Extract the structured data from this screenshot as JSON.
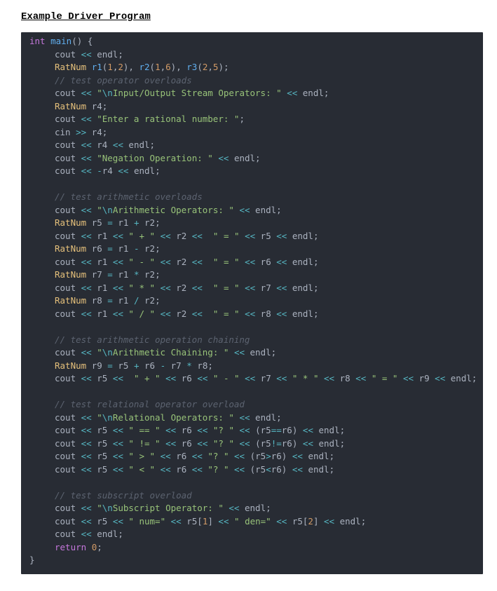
{
  "heading": "Example Driver Program",
  "code": {
    "lines": [
      {
        "indent": 0,
        "html": "<span class=\"k\">int</span> <span class=\"fn\">main</span><span class=\"p\">() {</span>"
      },
      {
        "indent": 1,
        "html": "<span class=\"v\">cout</span> <span class=\"o\">&lt;&lt;</span> <span class=\"v\">endl</span><span class=\"p\">;</span>"
      },
      {
        "indent": 1,
        "html": "<span class=\"ty\">RatNum</span> <span class=\"fn\">r1</span><span class=\"p\">(</span><span class=\"n\">1</span><span class=\"p\">,</span><span class=\"n\">2</span><span class=\"p\">)</span><span class=\"p\">,</span> <span class=\"fn\">r2</span><span class=\"p\">(</span><span class=\"n\">1</span><span class=\"p\">,</span><span class=\"n\">6</span><span class=\"p\">)</span><span class=\"p\">,</span> <span class=\"fn\">r3</span><span class=\"p\">(</span><span class=\"n\">2</span><span class=\"p\">,</span><span class=\"n\">5</span><span class=\"p\">)</span><span class=\"p\">;</span>"
      },
      {
        "indent": 1,
        "html": "<span class=\"c\">// test operator overloads</span>"
      },
      {
        "indent": 1,
        "html": "<span class=\"v\">cout</span> <span class=\"o\">&lt;&lt;</span> <span class=\"s\">\"</span><span class=\"esc\">\\n</span><span class=\"s\">Input/Output Stream Operators: \"</span> <span class=\"o\">&lt;&lt;</span> <span class=\"v\">endl</span><span class=\"p\">;</span>"
      },
      {
        "indent": 1,
        "html": "<span class=\"ty\">RatNum</span> <span class=\"v\">r4</span><span class=\"p\">;</span>"
      },
      {
        "indent": 1,
        "html": "<span class=\"v\">cout</span> <span class=\"o\">&lt;&lt;</span> <span class=\"s\">\"Enter a rational number: \"</span><span class=\"p\">;</span>"
      },
      {
        "indent": 1,
        "html": "<span class=\"v\">cin</span> <span class=\"o\">&gt;&gt;</span> <span class=\"v\">r4</span><span class=\"p\">;</span>"
      },
      {
        "indent": 1,
        "html": "<span class=\"v\">cout</span> <span class=\"o\">&lt;&lt;</span> <span class=\"v\">r4</span> <span class=\"o\">&lt;&lt;</span> <span class=\"v\">endl</span><span class=\"p\">;</span>"
      },
      {
        "indent": 1,
        "html": "<span class=\"v\">cout</span> <span class=\"o\">&lt;&lt;</span> <span class=\"s\">\"Negation Operation: \"</span> <span class=\"o\">&lt;&lt;</span> <span class=\"v\">endl</span><span class=\"p\">;</span>"
      },
      {
        "indent": 1,
        "html": "<span class=\"v\">cout</span> <span class=\"o\">&lt;&lt;</span> <span class=\"o\">-</span><span class=\"v\">r4</span> <span class=\"o\">&lt;&lt;</span> <span class=\"v\">endl</span><span class=\"p\">;</span>"
      },
      {
        "indent": 1,
        "html": "&nbsp;"
      },
      {
        "indent": 1,
        "html": "<span class=\"c\">// test arithmetic overloads</span>"
      },
      {
        "indent": 1,
        "html": "<span class=\"v\">cout</span> <span class=\"o\">&lt;&lt;</span> <span class=\"s\">\"</span><span class=\"esc\">\\n</span><span class=\"s\">Arithmetic Operators: \"</span> <span class=\"o\">&lt;&lt;</span> <span class=\"v\">endl</span><span class=\"p\">;</span>"
      },
      {
        "indent": 1,
        "html": "<span class=\"ty\">RatNum</span> <span class=\"v\">r5</span> <span class=\"o\">=</span> <span class=\"v\">r1</span> <span class=\"o\">+</span> <span class=\"v\">r2</span><span class=\"p\">;</span>"
      },
      {
        "indent": 1,
        "html": "<span class=\"v\">cout</span> <span class=\"o\">&lt;&lt;</span> <span class=\"v\">r1</span> <span class=\"o\">&lt;&lt;</span> <span class=\"s\">\" + \"</span> <span class=\"o\">&lt;&lt;</span> <span class=\"v\">r2</span> <span class=\"o\">&lt;&lt;</span>  <span class=\"s\">\" = \"</span> <span class=\"o\">&lt;&lt;</span> <span class=\"v\">r5</span> <span class=\"o\">&lt;&lt;</span> <span class=\"v\">endl</span><span class=\"p\">;</span>"
      },
      {
        "indent": 1,
        "html": "<span class=\"ty\">RatNum</span> <span class=\"v\">r6</span> <span class=\"o\">=</span> <span class=\"v\">r1</span> <span class=\"o\">-</span> <span class=\"v\">r2</span><span class=\"p\">;</span>"
      },
      {
        "indent": 1,
        "html": "<span class=\"v\">cout</span> <span class=\"o\">&lt;&lt;</span> <span class=\"v\">r1</span> <span class=\"o\">&lt;&lt;</span> <span class=\"s\">\" - \"</span> <span class=\"o\">&lt;&lt;</span> <span class=\"v\">r2</span> <span class=\"o\">&lt;&lt;</span>  <span class=\"s\">\" = \"</span> <span class=\"o\">&lt;&lt;</span> <span class=\"v\">r6</span> <span class=\"o\">&lt;&lt;</span> <span class=\"v\">endl</span><span class=\"p\">;</span>"
      },
      {
        "indent": 1,
        "html": "<span class=\"ty\">RatNum</span> <span class=\"v\">r7</span> <span class=\"o\">=</span> <span class=\"v\">r1</span> <span class=\"o\">*</span> <span class=\"v\">r2</span><span class=\"p\">;</span>"
      },
      {
        "indent": 1,
        "html": "<span class=\"v\">cout</span> <span class=\"o\">&lt;&lt;</span> <span class=\"v\">r1</span> <span class=\"o\">&lt;&lt;</span> <span class=\"s\">\" * \"</span> <span class=\"o\">&lt;&lt;</span> <span class=\"v\">r2</span> <span class=\"o\">&lt;&lt;</span>  <span class=\"s\">\" = \"</span> <span class=\"o\">&lt;&lt;</span> <span class=\"v\">r7</span> <span class=\"o\">&lt;&lt;</span> <span class=\"v\">endl</span><span class=\"p\">;</span>"
      },
      {
        "indent": 1,
        "html": "<span class=\"ty\">RatNum</span> <span class=\"v\">r8</span> <span class=\"o\">=</span> <span class=\"v\">r1</span> <span class=\"o\">/</span> <span class=\"v\">r2</span><span class=\"p\">;</span>"
      },
      {
        "indent": 1,
        "html": "<span class=\"v\">cout</span> <span class=\"o\">&lt;&lt;</span> <span class=\"v\">r1</span> <span class=\"o\">&lt;&lt;</span> <span class=\"s\">\" / \"</span> <span class=\"o\">&lt;&lt;</span> <span class=\"v\">r2</span> <span class=\"o\">&lt;&lt;</span>  <span class=\"s\">\" = \"</span> <span class=\"o\">&lt;&lt;</span> <span class=\"v\">r8</span> <span class=\"o\">&lt;&lt;</span> <span class=\"v\">endl</span><span class=\"p\">;</span>"
      },
      {
        "indent": 1,
        "html": "&nbsp;"
      },
      {
        "indent": 1,
        "html": "<span class=\"c\">// test arithmetic operation chaining</span>"
      },
      {
        "indent": 1,
        "html": "<span class=\"v\">cout</span> <span class=\"o\">&lt;&lt;</span> <span class=\"s\">\"</span><span class=\"esc\">\\n</span><span class=\"s\">Arithmetic Chaining: \"</span> <span class=\"o\">&lt;&lt;</span> <span class=\"v\">endl</span><span class=\"p\">;</span>"
      },
      {
        "indent": 1,
        "html": "<span class=\"ty\">RatNum</span> <span class=\"v\">r9</span> <span class=\"o\">=</span> <span class=\"v\">r5</span> <span class=\"o\">+</span> <span class=\"v\">r6</span> <span class=\"o\">-</span> <span class=\"v\">r7</span> <span class=\"o\">*</span> <span class=\"v\">r8</span><span class=\"p\">;</span>"
      },
      {
        "indent": 1,
        "html": "<span class=\"v\">cout</span> <span class=\"o\">&lt;&lt;</span> <span class=\"v\">r5</span> <span class=\"o\">&lt;&lt;</span>  <span class=\"s\">\" + \"</span> <span class=\"o\">&lt;&lt;</span> <span class=\"v\">r6</span> <span class=\"o\">&lt;&lt;</span> <span class=\"s\">\" - \"</span> <span class=\"o\">&lt;&lt;</span> <span class=\"v\">r7</span> <span class=\"o\">&lt;&lt;</span> <span class=\"s\">\" * \"</span> <span class=\"o\">&lt;&lt;</span> <span class=\"v\">r8</span> <span class=\"o\">&lt;&lt;</span> <span class=\"s\">\" = \"</span> <span class=\"o\">&lt;&lt;</span> <span class=\"v\">r9</span> <span class=\"o\">&lt;&lt;</span> <span class=\"v\">endl</span><span class=\"p\">;</span>"
      },
      {
        "indent": 1,
        "html": "&nbsp;"
      },
      {
        "indent": 1,
        "html": "<span class=\"c\">// test relational operator overload</span>"
      },
      {
        "indent": 1,
        "html": "<span class=\"v\">cout</span> <span class=\"o\">&lt;&lt;</span> <span class=\"s\">\"</span><span class=\"esc\">\\n</span><span class=\"s\">Relational Operators: \"</span> <span class=\"o\">&lt;&lt;</span> <span class=\"v\">endl</span><span class=\"p\">;</span>"
      },
      {
        "indent": 1,
        "html": "<span class=\"v\">cout</span> <span class=\"o\">&lt;&lt;</span> <span class=\"v\">r5</span> <span class=\"o\">&lt;&lt;</span> <span class=\"s\">\" == \"</span> <span class=\"o\">&lt;&lt;</span> <span class=\"v\">r6</span> <span class=\"o\">&lt;&lt;</span> <span class=\"s\">\"? \"</span> <span class=\"o\">&lt;&lt;</span> <span class=\"p\">(</span><span class=\"v\">r5</span><span class=\"o\">==</span><span class=\"v\">r6</span><span class=\"p\">)</span> <span class=\"o\">&lt;&lt;</span> <span class=\"v\">endl</span><span class=\"p\">;</span>"
      },
      {
        "indent": 1,
        "html": "<span class=\"v\">cout</span> <span class=\"o\">&lt;&lt;</span> <span class=\"v\">r5</span> <span class=\"o\">&lt;&lt;</span> <span class=\"s\">\" != \"</span> <span class=\"o\">&lt;&lt;</span> <span class=\"v\">r6</span> <span class=\"o\">&lt;&lt;</span> <span class=\"s\">\"? \"</span> <span class=\"o\">&lt;&lt;</span> <span class=\"p\">(</span><span class=\"v\">r5</span><span class=\"o\">!=</span><span class=\"v\">r6</span><span class=\"p\">)</span> <span class=\"o\">&lt;&lt;</span> <span class=\"v\">endl</span><span class=\"p\">;</span>"
      },
      {
        "indent": 1,
        "html": "<span class=\"v\">cout</span> <span class=\"o\">&lt;&lt;</span> <span class=\"v\">r5</span> <span class=\"o\">&lt;&lt;</span> <span class=\"s\">\" &gt; \"</span> <span class=\"o\">&lt;&lt;</span> <span class=\"v\">r6</span> <span class=\"o\">&lt;&lt;</span> <span class=\"s\">\"? \"</span> <span class=\"o\">&lt;&lt;</span> <span class=\"p\">(</span><span class=\"v\">r5</span><span class=\"o\">&gt;</span><span class=\"v\">r6</span><span class=\"p\">)</span> <span class=\"o\">&lt;&lt;</span> <span class=\"v\">endl</span><span class=\"p\">;</span>"
      },
      {
        "indent": 1,
        "html": "<span class=\"v\">cout</span> <span class=\"o\">&lt;&lt;</span> <span class=\"v\">r5</span> <span class=\"o\">&lt;&lt;</span> <span class=\"s\">\" &lt; \"</span> <span class=\"o\">&lt;&lt;</span> <span class=\"v\">r6</span> <span class=\"o\">&lt;&lt;</span> <span class=\"s\">\"? \"</span> <span class=\"o\">&lt;&lt;</span> <span class=\"p\">(</span><span class=\"v\">r5</span><span class=\"o\">&lt;</span><span class=\"v\">r6</span><span class=\"p\">)</span> <span class=\"o\">&lt;&lt;</span> <span class=\"v\">endl</span><span class=\"p\">;</span>"
      },
      {
        "indent": 1,
        "html": "&nbsp;"
      },
      {
        "indent": 1,
        "html": "<span class=\"c\">// test subscript overload</span>"
      },
      {
        "indent": 1,
        "html": "<span class=\"v\">cout</span> <span class=\"o\">&lt;&lt;</span> <span class=\"s\">\"</span><span class=\"esc\">\\n</span><span class=\"s\">Subscript Operator: \"</span> <span class=\"o\">&lt;&lt;</span> <span class=\"v\">endl</span><span class=\"p\">;</span>"
      },
      {
        "indent": 1,
        "html": "<span class=\"v\">cout</span> <span class=\"o\">&lt;&lt;</span> <span class=\"v\">r5</span> <span class=\"o\">&lt;&lt;</span> <span class=\"s\">\" num=\"</span> <span class=\"o\">&lt;&lt;</span> <span class=\"v\">r5</span><span class=\"p\">[</span><span class=\"n\">1</span><span class=\"p\">]</span> <span class=\"o\">&lt;&lt;</span> <span class=\"s\">\" den=\"</span> <span class=\"o\">&lt;&lt;</span> <span class=\"v\">r5</span><span class=\"p\">[</span><span class=\"n\">2</span><span class=\"p\">]</span> <span class=\"o\">&lt;&lt;</span> <span class=\"v\">endl</span><span class=\"p\">;</span>"
      },
      {
        "indent": 1,
        "html": "<span class=\"v\">cout</span> <span class=\"o\">&lt;&lt;</span> <span class=\"v\">endl</span><span class=\"p\">;</span>"
      },
      {
        "indent": 1,
        "html": "<span class=\"k\">return</span> <span class=\"n\">0</span><span class=\"p\">;</span>"
      },
      {
        "indent": 0,
        "html": "<span class=\"p\">}</span>"
      }
    ]
  }
}
